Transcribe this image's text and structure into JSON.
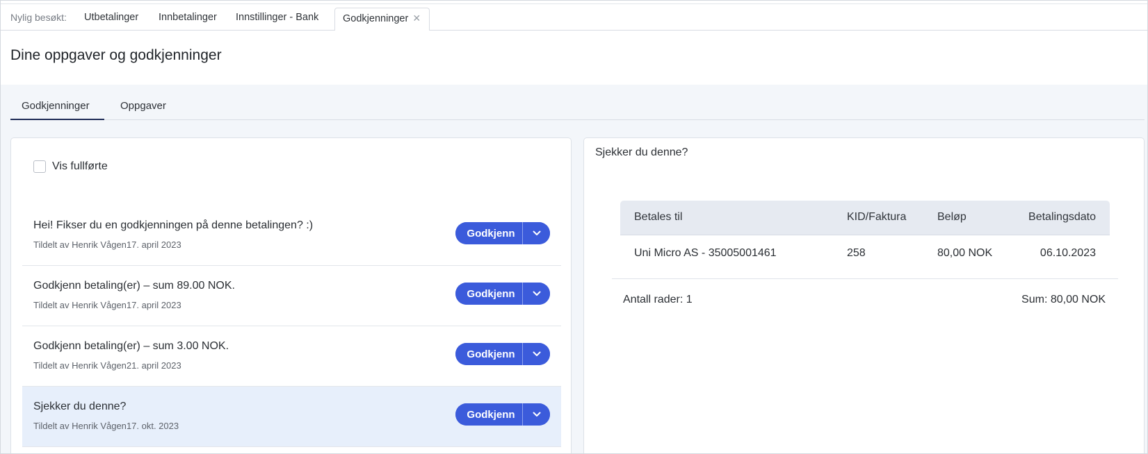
{
  "recent": {
    "label": "Nylig besøkt:",
    "tabs": [
      "Utbetalinger",
      "Innbetalinger",
      "Innstillinger - Bank"
    ],
    "active_tab": "Godkjenninger",
    "close_glyph": "✕"
  },
  "header": {
    "title": "Dine oppgaver og godkjenninger"
  },
  "tabs": {
    "approvals": "Godkjenninger",
    "tasks": "Oppgaver"
  },
  "filters": {
    "show_completed": "Vis fullførte"
  },
  "tasks": [
    {
      "title": "Hei! Fikser du en godkjenningen på denne betalingen? :)",
      "meta": "Tildelt av Henrik Vågen17. april 2023",
      "button": "Godkjenn"
    },
    {
      "title": "Godkjenn betaling(er) – sum 89.00 NOK.",
      "meta": "Tildelt av Henrik Vågen17. april 2023",
      "button": "Godkjenn"
    },
    {
      "title": "Godkjenn betaling(er) – sum 3.00 NOK.",
      "meta": "Tildelt av Henrik Vågen21. april 2023",
      "button": "Godkjenn"
    },
    {
      "title": "Sjekker du denne?",
      "meta": "Tildelt av Henrik Vågen17. okt. 2023",
      "button": "Godkjenn"
    }
  ],
  "detail": {
    "title": "Sjekker du denne?",
    "columns": [
      "Betales til",
      "KID/Faktura",
      "Beløp",
      "Betalingsdato"
    ],
    "rows": [
      [
        "Uni Micro AS - 35005001461",
        "258",
        "80,00 NOK",
        "06.10.2023"
      ]
    ],
    "row_count": "Antall rader: 1",
    "sum": "Sum: 80,00 NOK"
  },
  "colors": {
    "primary": "#3b5bdb",
    "selected_row": "#e7effb",
    "content_bg": "#f3f6fa",
    "tab_underline": "#1d2a55"
  },
  "icons": {
    "dropdown": "chevron-down-icon",
    "close": "close-icon"
  }
}
